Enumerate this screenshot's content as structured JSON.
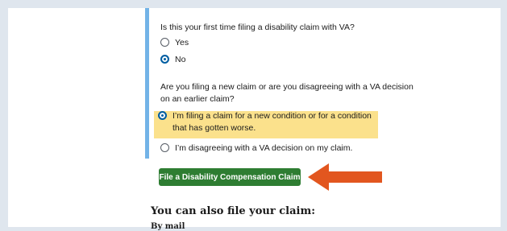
{
  "form": {
    "q1": {
      "label": "Is this your first time filing a disability claim with VA?",
      "options": [
        {
          "label": "Yes",
          "selected": false
        },
        {
          "label": "No",
          "selected": true
        }
      ]
    },
    "q2": {
      "label_line1": "Are you filing a new claim or are you disagreeing with a VA decision",
      "label_line2": "on an earlier claim?",
      "options": [
        {
          "label": "I’m filing a claim for a new condition or for a condition that has gotten worse.",
          "selected": true
        },
        {
          "label": "I’m disagreeing with a VA decision on my claim.",
          "selected": false
        }
      ]
    },
    "cta_label": "File a Disability Compensation Claim"
  },
  "section": {
    "heading": "You can also file your claim:",
    "subheading": "By mail"
  },
  "colors": {
    "accent": "#73b3e7",
    "highlight": "#fbe18c",
    "cta": "#2e7d32",
    "arrow": "#e2561f",
    "radio_selected": "#005ea2"
  }
}
